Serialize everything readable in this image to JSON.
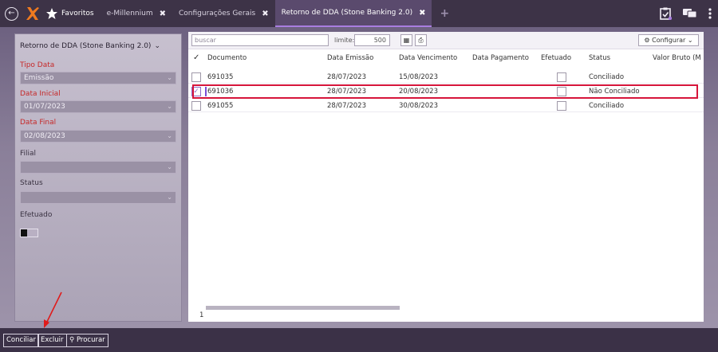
{
  "topbar": {
    "back_icon": "back-arrow-circle-icon",
    "logo": "orange-x-logo",
    "tabs": [
      {
        "label": "Favoritos"
      },
      {
        "label": "e-Millennium",
        "close": "✖"
      },
      {
        "label": "Configurações Gerais",
        "close": "✖"
      },
      {
        "label": "Retorno de DDA (Stone Banking 2.0)",
        "close": "✖",
        "active": true
      }
    ],
    "add_tab": "+",
    "right_icons": [
      "clipboard-check-icon",
      "chat-icon",
      "kebab-menu-icon"
    ]
  },
  "filters": {
    "title": "Retorno de DDA (Stone Banking 2.0)",
    "tipo_data": {
      "label": "Tipo Data",
      "value": "Emissão"
    },
    "data_inicial": {
      "label": "Data Inicial",
      "value": "01/07/2023"
    },
    "data_final": {
      "label": "Data Final",
      "value": "02/08/2023"
    },
    "filial": {
      "label": "Filial",
      "value": ""
    },
    "status": {
      "label": "Status",
      "value": ""
    },
    "efetuado": {
      "label": "Efetuado"
    }
  },
  "toolbar": {
    "search_placeholder": "buscar",
    "limit_label": "limite:",
    "limit_value": "500",
    "configurar_label": "Configurar"
  },
  "table": {
    "columns": [
      "Documento",
      "Data Emissão",
      "Data Vencimento",
      "Data Pagamento",
      "Efetuado",
      "Status",
      "Valor Bruto (M"
    ],
    "rows": [
      {
        "documento": "691035",
        "emissao": "28/07/2023",
        "vencimento": "15/08/2023",
        "pagamento": "",
        "status": "Conciliado",
        "checked": false
      },
      {
        "documento": "691036",
        "emissao": "28/07/2023",
        "vencimento": "20/08/2023",
        "pagamento": "",
        "status": "Não Conciliado",
        "checked": true
      },
      {
        "documento": "691055",
        "emissao": "28/07/2023",
        "vencimento": "30/08/2023",
        "pagamento": "",
        "status": "Conciliado",
        "checked": false
      }
    ],
    "page": "1"
  },
  "bottom": {
    "conciliar": "Conciliar",
    "excluir": "Excluir",
    "procurar": "Procurar"
  },
  "colors": {
    "accent": "#a97ee0",
    "highlight_box": "#d6153b",
    "required_label": "#c62828"
  }
}
